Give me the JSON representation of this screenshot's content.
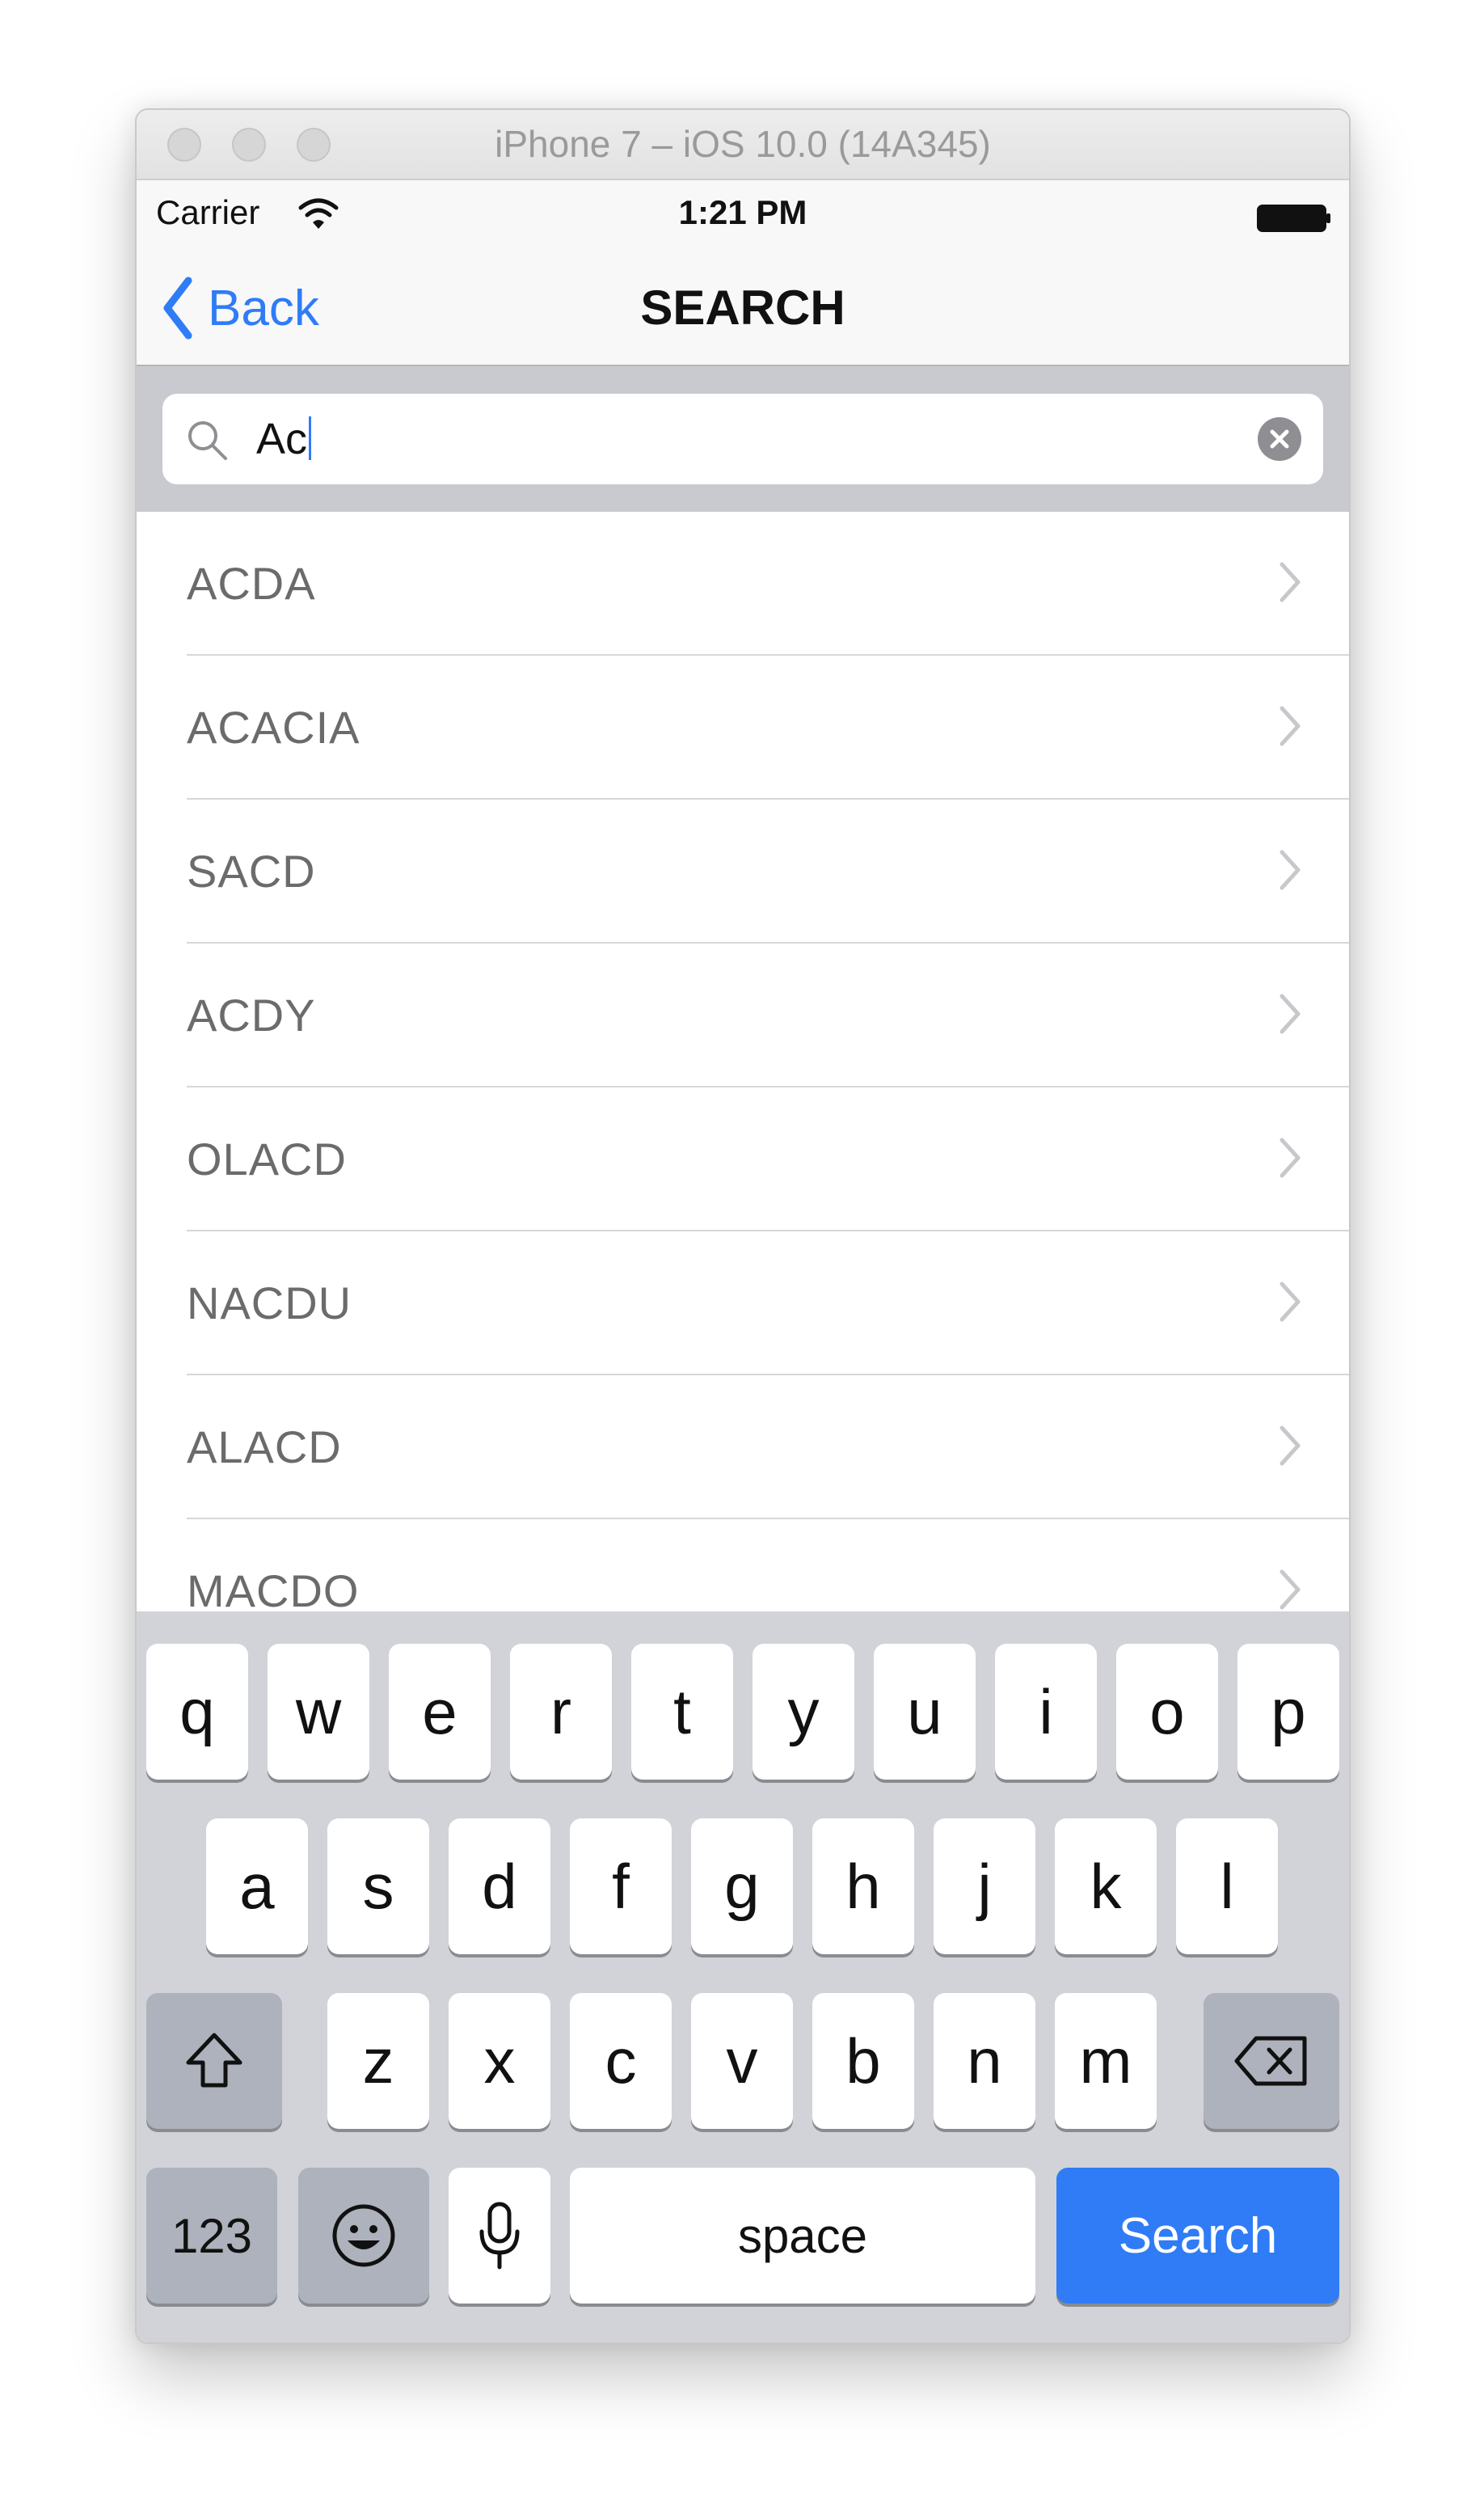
{
  "window": {
    "title": "iPhone 7 – iOS 10.0 (14A345)"
  },
  "status_bar": {
    "carrier": "Carrier",
    "time": "1:21 PM"
  },
  "nav": {
    "back_label": "Back",
    "title": "SEARCH"
  },
  "search": {
    "value": "Ac"
  },
  "results": [
    {
      "label": "ACDA"
    },
    {
      "label": "ACACIA"
    },
    {
      "label": "SACD"
    },
    {
      "label": "ACDY"
    },
    {
      "label": "OLACD"
    },
    {
      "label": "NACDU"
    },
    {
      "label": "ALACD"
    },
    {
      "label": "MACDO"
    }
  ],
  "keyboard": {
    "row1": [
      "q",
      "w",
      "e",
      "r",
      "t",
      "y",
      "u",
      "i",
      "o",
      "p"
    ],
    "row2": [
      "a",
      "s",
      "d",
      "f",
      "g",
      "h",
      "j",
      "k",
      "l"
    ],
    "row3": [
      "z",
      "x",
      "c",
      "v",
      "b",
      "n",
      "m"
    ],
    "numbers_label": "123",
    "space_label": "space",
    "search_label": "Search"
  },
  "colors": {
    "accent": "#2f7cf6",
    "keyboard_bg": "#d1d3d9",
    "search_bar_bg": "#c9cacf"
  },
  "icons": {
    "back": "chevron-left-icon",
    "search": "magnifier-icon",
    "clear": "clear-circle-x-icon",
    "row": "chevron-right-icon",
    "shift": "shift-arrow-icon",
    "delete": "backspace-icon",
    "emoji": "emoji-face-icon",
    "mic": "microphone-icon"
  }
}
